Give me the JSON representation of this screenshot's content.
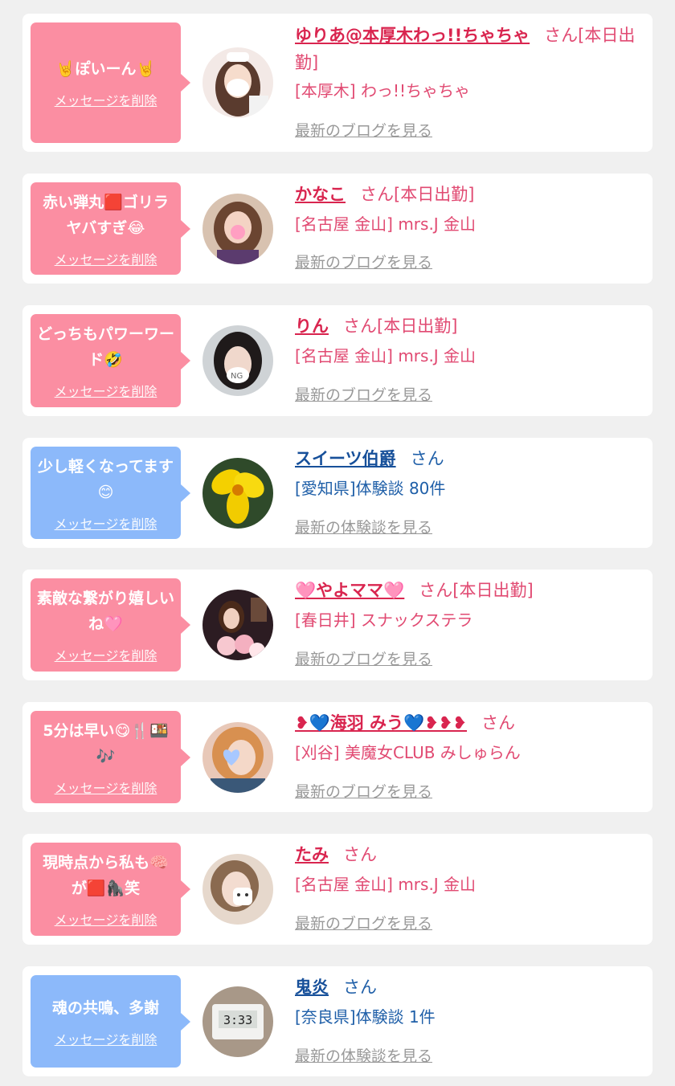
{
  "delete_label": "メッセージを削除",
  "san": "さん",
  "entries": [
    {
      "message": "🤘ぽいーん🤘",
      "name": "ゆりあ@本厚木わっ!!ちゃちゃ",
      "status": "[本日出勤]",
      "shop": "[本厚木] わっ!!ちゃちゃ",
      "link": "最新のブログを見る",
      "theme": "pink",
      "avatar": "woman-white-mask-avatar"
    },
    {
      "message": "赤い弾丸🟥ゴリラヤバすぎ😂",
      "name": "かなこ",
      "status": "[本日出勤]",
      "shop": "[名古屋 金山] mrs.J 金山",
      "link": "最新のブログを見る",
      "theme": "pink",
      "avatar": "woman-pig-sticker-avatar"
    },
    {
      "message": "どっちもパワーワード🤣",
      "name": "りん",
      "status": "[本日出勤]",
      "shop": "[名古屋 金山] mrs.J 金山",
      "link": "最新のブログを見る",
      "theme": "pink",
      "avatar": "woman-ng-sticker-avatar"
    },
    {
      "message": "少し軽くなってます😊",
      "name": "スイーツ伯爵",
      "status": "",
      "shop": "[愛知県]体験談 80件",
      "link": "最新の体験談を見る",
      "theme": "blue",
      "avatar": "yellow-flower-avatar"
    },
    {
      "message": "素敵な繋がり嬉しいね🩷",
      "name": "🩷やよママ🩷",
      "status": "[本日出勤]",
      "shop": "[春日井] スナックステラ",
      "link": "最新のブログを見る",
      "theme": "pink",
      "avatar": "woman-flowers-avatar"
    },
    {
      "message": "5分は早い😋🍴🍱🎶",
      "name": "❥💙海羽 みう💙❥❥❥",
      "status": "",
      "shop": "[刈谷] 美魔女CLUB みしゅらん",
      "link": "最新のブログを見る",
      "theme": "pink",
      "avatar": "woman-blue-heart-avatar"
    },
    {
      "message": "現時点から私も🧠が🟥🦍笑",
      "name": "たみ",
      "status": "",
      "shop": "[名古屋 金山] mrs.J 金山",
      "link": "最新のブログを見る",
      "theme": "pink",
      "avatar": "woman-face-sticker-avatar"
    },
    {
      "message": "魂の共鳴、多謝",
      "name": "鬼炎",
      "status": "",
      "shop": "[奈良県]体験談 1件",
      "link": "最新の体験談を見る",
      "theme": "blue",
      "avatar": "digital-clock-avatar"
    }
  ]
}
